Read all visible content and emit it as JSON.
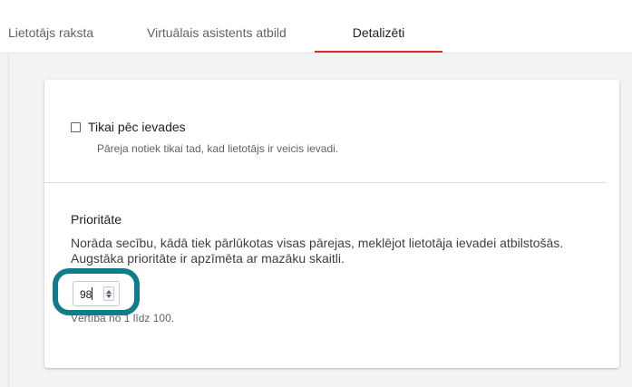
{
  "tabs": {
    "items": [
      {
        "label": "Lietotājs raksta"
      },
      {
        "label": "Virtuālais asistents atbild"
      },
      {
        "label": "Detalizēti"
      }
    ],
    "active_index": 2,
    "accent_color": "#d93025"
  },
  "card": {
    "checkbox": {
      "label": "Tikai pēc ievades",
      "checked": false,
      "help": "Pāreja notiek tikai tad, kad lietotājs ir veicis ievadi."
    },
    "priority": {
      "title": "Prioritāte",
      "description": "Norāda secību, kādā tiek pārlūkotas visas pārejas, meklējot lietotāja ievadei atbilstošās. Augstāka prioritāte ir apzīmēta ar mazāku skaitli.",
      "value": "98",
      "range_hint": "Vērtība no 1 līdz 100."
    }
  },
  "highlight_color": "#0f7c8a"
}
